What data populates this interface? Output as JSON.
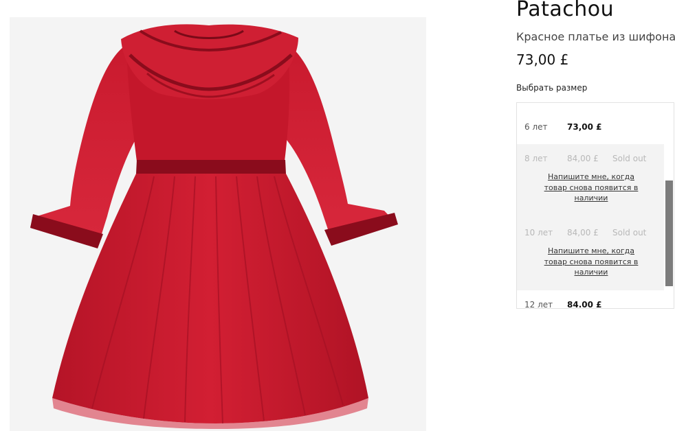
{
  "product": {
    "brand": "Patachou",
    "name": "Красное платье из шифона",
    "price": "73,00 £",
    "image_icon": "red-chiffon-dress-photo"
  },
  "size_selector": {
    "label": "Выбрать размер",
    "options": [
      {
        "size": "6 лет",
        "price": "73,00 £",
        "status": "",
        "available": true,
        "notify_label": ""
      },
      {
        "size": "8 лет",
        "price": "84,00 £",
        "status": "Sold out",
        "available": false,
        "notify_label": "Напишите мне, когда товар снова появится в наличии"
      },
      {
        "size": "10 лет",
        "price": "84,00 £",
        "status": "Sold out",
        "available": false,
        "notify_label": "Напишите мне, когда товар снова появится в наличии"
      },
      {
        "size": "12 лет",
        "price": "84.00 £",
        "status": "",
        "available": true,
        "notify_label": ""
      }
    ]
  },
  "colors": {
    "dress_red": "#c4172b",
    "dress_shadow": "#9e0f20",
    "velvet_trim": "#8a0c1c",
    "scrollbar_thumb": "#7c7c7c"
  }
}
